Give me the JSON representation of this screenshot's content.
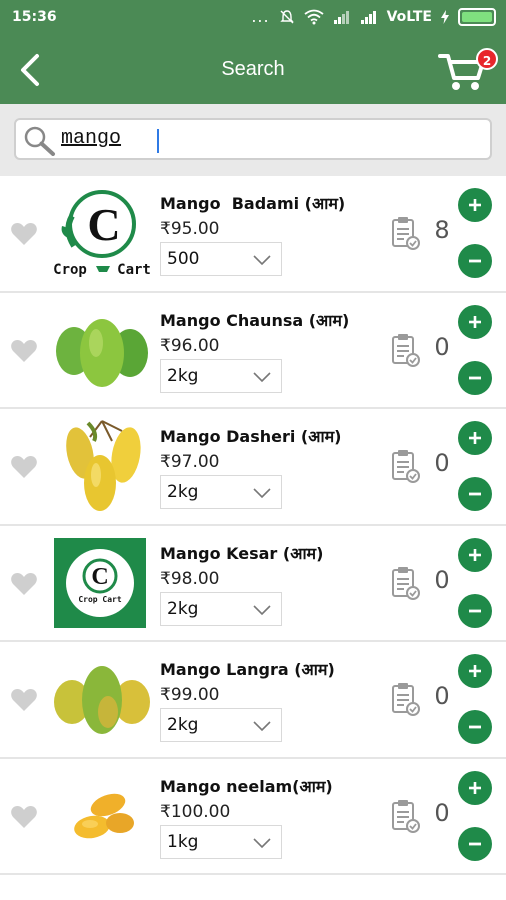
{
  "status_bar": {
    "time": "15:36",
    "dots": "...",
    "network": "VoLTE"
  },
  "app_bar": {
    "title": "Search",
    "cart_count": "2"
  },
  "search": {
    "value": "mango"
  },
  "products": [
    {
      "name": "Mango  Badami (आम)",
      "price": "₹95.00",
      "unit": "500",
      "quantity": "8",
      "image": "logo"
    },
    {
      "name": "Mango Chaunsa (आम)",
      "price": "₹96.00",
      "unit": "2kg",
      "quantity": "0",
      "image": "green-mango"
    },
    {
      "name": "Mango Dasheri (आम)",
      "price": "₹97.00",
      "unit": "2kg",
      "quantity": "0",
      "image": "yellow-mango-bunch"
    },
    {
      "name": "Mango Kesar (आम)",
      "price": "₹98.00",
      "unit": "2kg",
      "quantity": "0",
      "image": "logo-green-tile"
    },
    {
      "name": "Mango Langra (आम)",
      "price": "₹99.00",
      "unit": "2kg",
      "quantity": "0",
      "image": "green-yellow-mango"
    },
    {
      "name": "Mango neelam(आम)",
      "price": "₹100.00",
      "unit": "1kg",
      "quantity": "0",
      "image": "small-yellow-mango"
    }
  ],
  "logo_text": {
    "word1": "Crop",
    "word2": "Cart",
    "mark": "C"
  },
  "colors": {
    "primary": "#4b8a55",
    "button": "#1f8a49",
    "badge": "#e8262b"
  },
  "icons": {
    "back": "back-arrow-icon",
    "cart": "cart-icon",
    "search": "search-icon",
    "favorite": "heart-icon",
    "note": "clipboard-icon",
    "add": "plus-icon",
    "remove": "minus-icon",
    "dropdown": "chevron-down-icon"
  }
}
